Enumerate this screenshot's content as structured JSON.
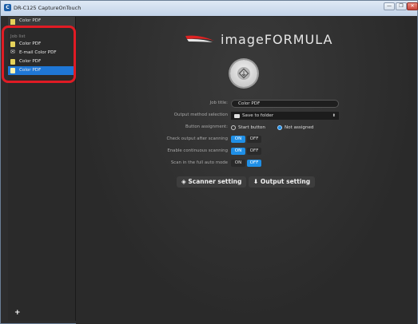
{
  "window": {
    "title": "DR-C125 CaptureOnTouch",
    "app_icon": "C",
    "controls": [
      "—",
      "❐",
      "✕"
    ]
  },
  "sidebar": {
    "top_item": "Color PDF",
    "section_label": "Job list",
    "items": [
      {
        "label": "Color PDF",
        "icon": "document-icon",
        "selected": false
      },
      {
        "label": "E-mail Color PDF",
        "icon": "email-icon",
        "selected": false
      },
      {
        "label": "Color PDF",
        "icon": "document-icon",
        "selected": false
      },
      {
        "label": "Color PDF",
        "icon": "document-icon",
        "selected": true
      }
    ],
    "add_label": "+"
  },
  "logo": {
    "text": "imageFORMULA"
  },
  "form": {
    "job_title_label": "Job title:",
    "job_title_value": "Color PDF",
    "output_method_label": "Output method selection",
    "output_method_value": "Save to folder",
    "button_assignment_label": "Button assignment:",
    "button_assignment_options": [
      {
        "label": "Start button",
        "selected": false
      },
      {
        "label": "Not assigned",
        "selected": true
      }
    ],
    "check_output_label": "Check output after scanning",
    "check_output": {
      "on": "ON",
      "off": "OFF",
      "value": "ON"
    },
    "continuous_label": "Enable continuous scanning",
    "continuous": {
      "on": "ON",
      "off": "OFF",
      "value": "ON"
    },
    "full_auto_label": "Scan in the full auto mode",
    "full_auto": {
      "on": "ON",
      "off": "OFF",
      "value": "OFF"
    }
  },
  "buttons": {
    "scanner_setting": "Scanner setting",
    "output_setting": "Output setting"
  },
  "colors": {
    "accent": "#1f8fe6",
    "highlight": "#e01b24",
    "background": "#2d2d2d"
  }
}
